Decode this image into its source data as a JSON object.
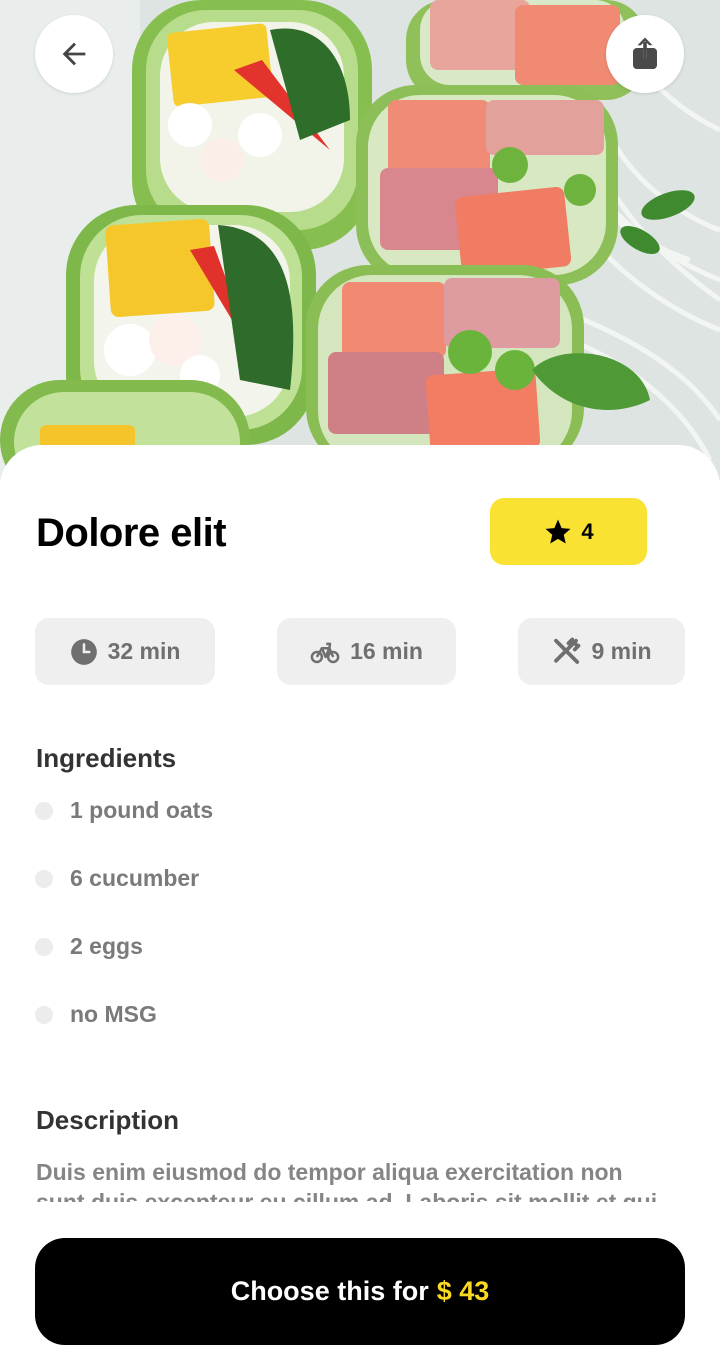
{
  "header": {
    "back_icon": "arrow-left-icon",
    "share_icon": "share-icon"
  },
  "dish": {
    "title": "Dolore elit",
    "rating": "4",
    "rating_icon": "star-icon"
  },
  "stats": [
    {
      "icon": "clock-icon",
      "value": "32 min"
    },
    {
      "icon": "bicycle-icon",
      "value": "16 min"
    },
    {
      "icon": "utensils-icon",
      "value": "9 min"
    }
  ],
  "ingredients": {
    "title": "Ingredients",
    "items": [
      "1 pound oats",
      "6 cucumber",
      "2 eggs",
      "no MSG"
    ]
  },
  "description": {
    "title": "Description",
    "text": "Duis enim eiusmod do tempor aliqua exercitation non sunt duis excepteur eu cillum ad. Laboris sit mollit et qui"
  },
  "cta": {
    "label": "Choose this for",
    "price": "$ 43"
  },
  "colors": {
    "accent": "#f9e232",
    "price": "#f9d923",
    "button": "#000000",
    "chip": "#efefef"
  }
}
